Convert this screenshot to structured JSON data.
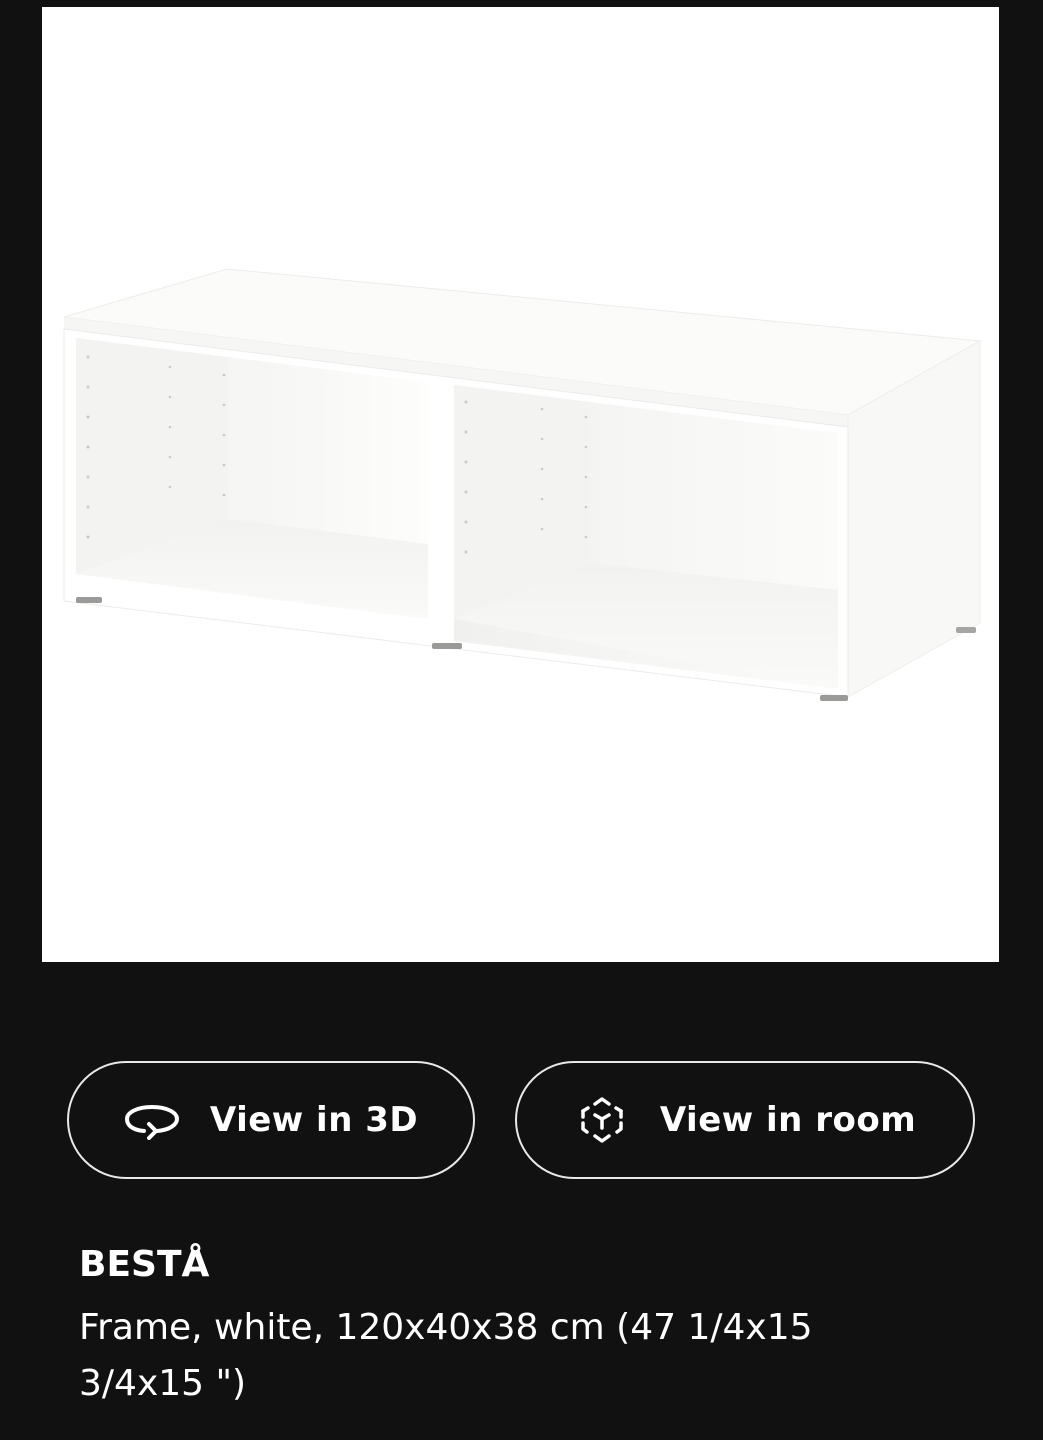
{
  "gallery": {
    "image_alt": "BESTÅ frame product image"
  },
  "actions": {
    "view_3d": {
      "label": "View in 3D",
      "icon": "rotate-3d-icon"
    },
    "view_room": {
      "label": "View in room",
      "icon": "ar-cube-icon"
    }
  },
  "product": {
    "name": "BESTÅ",
    "description": "Frame, white, 120x40x38 cm (47 1/4x15 3/4x15 \")"
  },
  "colors": {
    "background": "#111111",
    "image_bg": "#ffffff",
    "button_border": "#e8e8e8",
    "text": "#ffffff"
  }
}
